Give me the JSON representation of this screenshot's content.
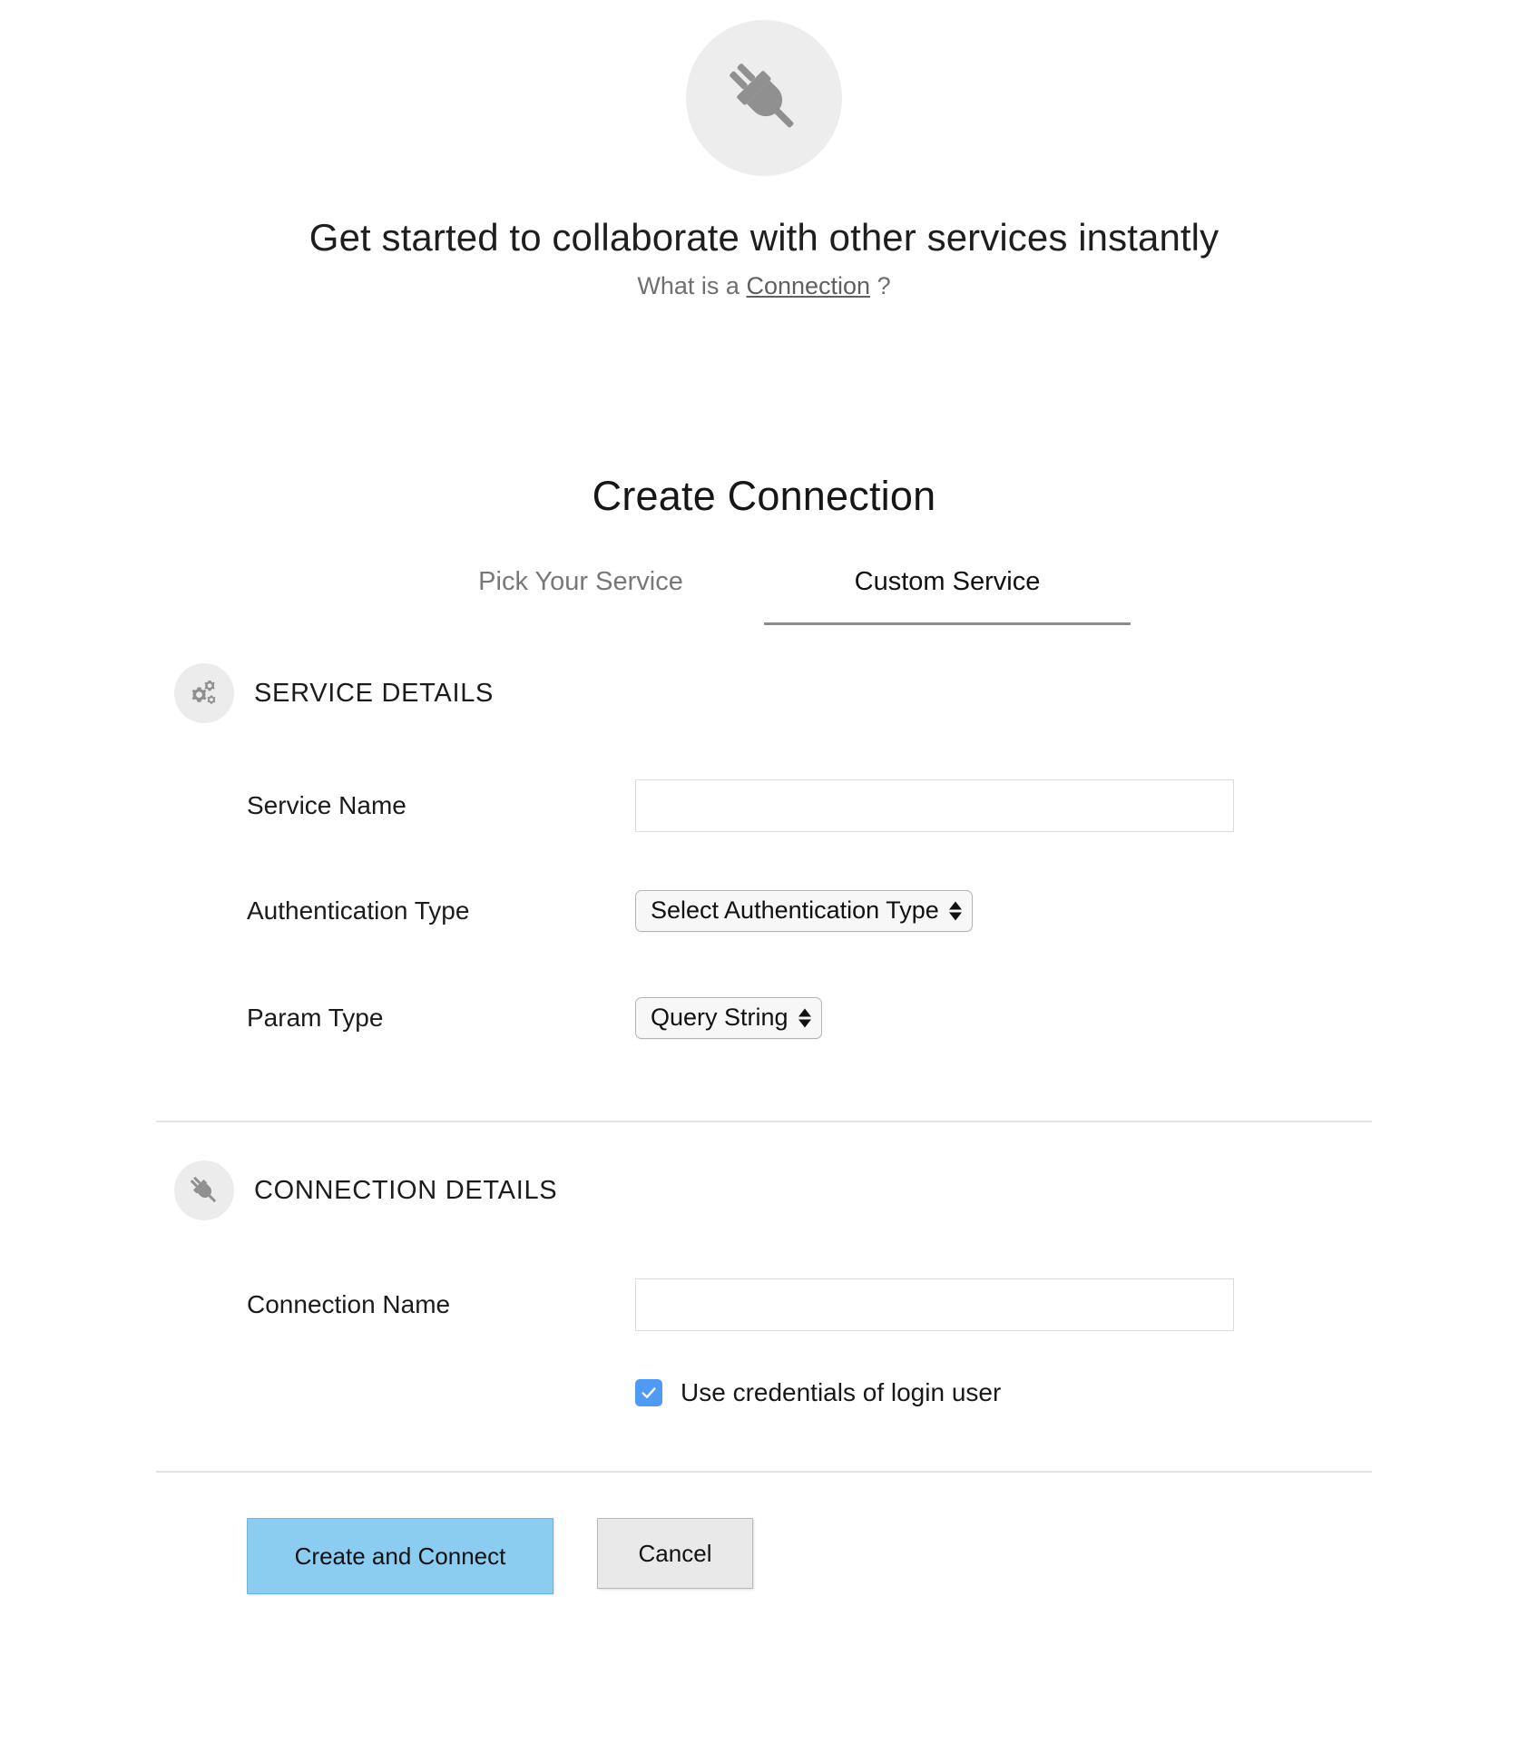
{
  "hero": {
    "icon": "plug-icon",
    "title": "Get started to collaborate with other services instantly",
    "sub_prefix": "What is a ",
    "sub_link": "Connection",
    "sub_suffix": " ?"
  },
  "card": {
    "title": "Create Connection"
  },
  "tabs": [
    {
      "label": "Pick Your Service",
      "active": false
    },
    {
      "label": "Custom Service",
      "active": true
    }
  ],
  "service_details": {
    "icon": "gears-icon",
    "heading": "SERVICE DETAILS",
    "fields": {
      "service_name": {
        "label": "Service Name",
        "value": "",
        "placeholder": ""
      },
      "authentication_type": {
        "label": "Authentication Type",
        "selected": "Select Authentication Type"
      },
      "param_type": {
        "label": "Param Type",
        "selected": "Query String"
      }
    }
  },
  "connection_details": {
    "icon": "plug-icon",
    "heading": "CONNECTION DETAILS",
    "fields": {
      "connection_name": {
        "label": "Connection Name",
        "value": "",
        "placeholder": ""
      },
      "use_credentials": {
        "label": "Use credentials of login user",
        "checked": true
      }
    }
  },
  "actions": {
    "primary_label": "Create and Connect",
    "secondary_label": "Cancel"
  },
  "colors": {
    "primary_button": "#8ACDF0",
    "secondary_button": "#e9e9e9",
    "checkbox_accent": "#4e9af5",
    "badge_circle": "#ececec",
    "icon_gray": "#909090",
    "active_tab_underline": "#8c8c8c",
    "divider": "#e2e2e2",
    "input_border": "#dcdcdc"
  }
}
